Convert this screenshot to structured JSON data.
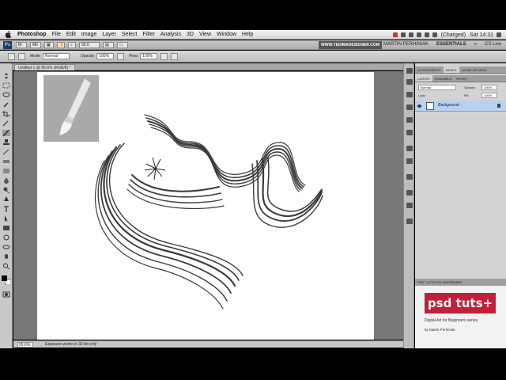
{
  "menubar": {
    "app_name": "Photoshop",
    "items": [
      "File",
      "Edit",
      "Image",
      "Layer",
      "Select",
      "Filter",
      "Analysis",
      "3D",
      "View",
      "Window",
      "Help"
    ],
    "battery": "(Charged)",
    "clock": "Sat 14:31"
  },
  "appbar": {
    "zoom": "95.6",
    "workspace_site": "WWW.YEDIMADESIGNER.COM",
    "workspaces": [
      "MARTIN PERHINIAK",
      "ESSENTIALS"
    ],
    "cs_live": "CS Live"
  },
  "options": {
    "mode_label": "Mode:",
    "mode_value": "Normal",
    "opacity_label": "Opacity:",
    "opacity_value": "100%",
    "flow_label": "Flow:",
    "flow_value": "100%"
  },
  "document": {
    "tab": "Untitled-1 @ 95.6% (RGB/8) *"
  },
  "status": {
    "zoom": "95.6%",
    "info": "Exposure works in 32-bit only"
  },
  "panels": {
    "top_tabs": [
      "ADJUSTMENTS",
      "MASKS",
      "LAYER OPTIONS"
    ],
    "layer_tabs": [
      "LAYERS",
      "CHANNELS",
      "PATHS"
    ],
    "blend_mode": "Normal",
    "opacity_label": "Opacity:",
    "opacity": "100%",
    "lock_label": "Lock:",
    "fill_label": "Fill:",
    "fill": "100%",
    "layer_name": "Background"
  },
  "watermark": {
    "tab": "PSD TUTSPLUS WATERMARK",
    "logo_text": "psd tuts+",
    "series": "Digital Art for Beginners series",
    "author": "by Martin Perhiniak"
  }
}
